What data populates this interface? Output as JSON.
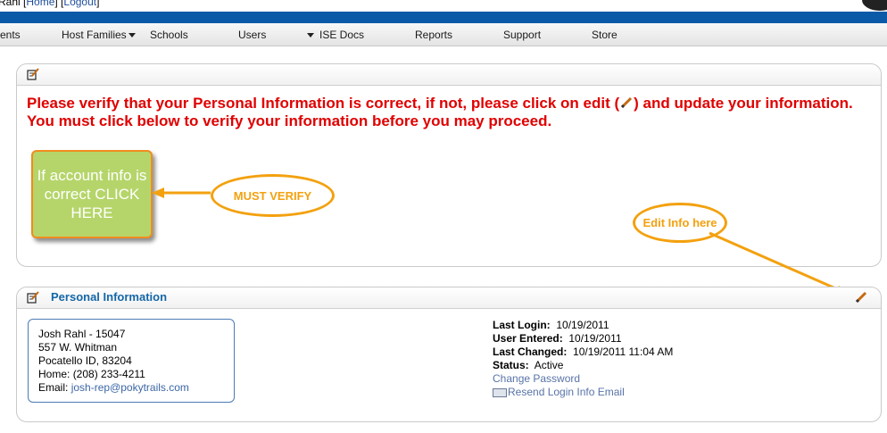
{
  "top": {
    "user_name": "Rahl",
    "home_link": "Home",
    "logout_link": "Logout"
  },
  "nav": {
    "items": [
      {
        "label": "ents"
      },
      {
        "label": "Host Families"
      },
      {
        "label": "Schools"
      },
      {
        "label": "Users"
      },
      {
        "label": "ISE Docs"
      },
      {
        "label": "Reports"
      },
      {
        "label": "Support"
      },
      {
        "label": "Store"
      }
    ]
  },
  "verify": {
    "message_line1": "Please verify that your Personal Information is correct, if not, please click on edit (",
    "message_line1_end": ") and update your information.",
    "message_line2": "You must click below to verify your information before you may proceed.",
    "button_label": "If account info is correct CLICK HERE",
    "callout_must": "MUST VERIFY",
    "callout_edit": "Edit Info here"
  },
  "personal": {
    "title": "Personal Information",
    "name_line": "Josh Rahl - 15047",
    "street": "557 W. Whitman",
    "city_line": "Pocatello ID, 83204",
    "home_label": "Home:",
    "home_phone": "(208) 233-4211",
    "email_label": "Email:",
    "email": "josh-rep@pokytrails.com",
    "last_login_label": "Last Login:",
    "last_login": "10/19/2011",
    "user_entered_label": "User Entered:",
    "user_entered": "10/19/2011",
    "last_changed_label": "Last Changed:",
    "last_changed": "10/19/2011 11:04 AM",
    "status_label": "Status:",
    "status": "Active",
    "change_password": "Change Password",
    "resend_login": "Resend Login Info Email"
  },
  "colors": {
    "brand_blue": "#0a5aa8",
    "alert_red": "#e00000",
    "callout_orange": "#f3a10f",
    "verify_green": "#b5d56a"
  }
}
